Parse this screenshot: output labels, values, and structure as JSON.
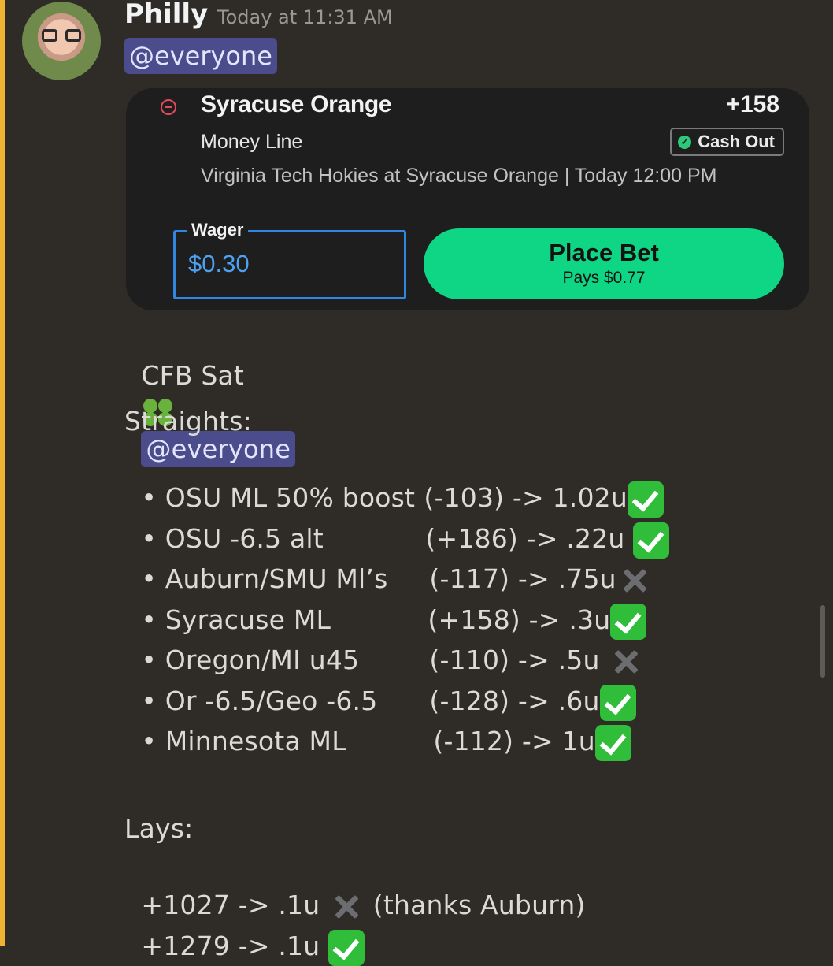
{
  "message": {
    "username": "Philly",
    "timestamp": "Today at 11:31 AM",
    "mention": "@everyone"
  },
  "bet_card": {
    "team": "Syracuse Orange",
    "odds": "+158",
    "bet_type": "Money Line",
    "cash_out_label": "Cash Out",
    "matchup": "Virginia Tech Hokies at Syracuse Orange | Today 12:00 PM",
    "wager_label": "Wager",
    "wager_value": "$0.30",
    "place_bet_label": "Place Bet",
    "pays_label": "Pays $0.77",
    "colors": {
      "accent_green": "#0fd685",
      "input_blue": "#2f87e2",
      "loss_red": "#e24b5a"
    }
  },
  "post": {
    "header_text": "CFB Sat",
    "header_emoji": "four-leaf-clover-icon",
    "header_mention": "@everyone",
    "straights_title": "Straights:",
    "straights": [
      {
        "pick": "• OSU ML 50% boost",
        "line": "(-103) -> 1.02u",
        "result": "check"
      },
      {
        "pick": "• OSU -6.5 alt",
        "line": "(+186) -> .22u",
        "result": "check"
      },
      {
        "pick": "• Auburn/SMU Ml’s",
        "line": "(-117) -> .75u",
        "result": "cross"
      },
      {
        "pick": "• Syracuse ML",
        "line": "(+158) -> .3u",
        "result": "check"
      },
      {
        "pick": "• Oregon/MI u45",
        "line": "(-110) -> .5u",
        "result": "cross"
      },
      {
        "pick": "• Or -6.5/Geo -6.5",
        "line": "(-128) -> .6u",
        "result": "check"
      },
      {
        "pick": "• Minnesota ML",
        "line": "(-112) -> 1u",
        "result": "check"
      }
    ],
    "lays_title": "Lays:",
    "lays": [
      {
        "line": "+1027 -> .1u",
        "result": "cross",
        "note": "(thanks Auburn)"
      },
      {
        "line": "+1279 -> .1u",
        "result": "check",
        "note": ""
      }
    ]
  }
}
